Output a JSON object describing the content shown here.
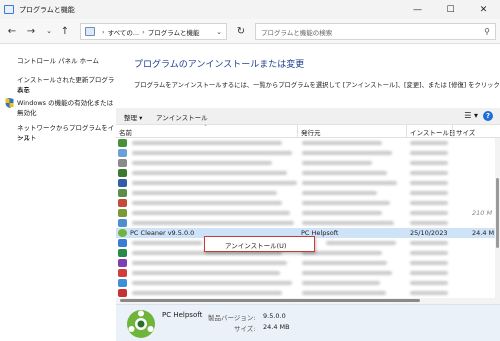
{
  "window": {
    "title": "プログラムと機能",
    "controls": [
      "minimize",
      "maximize",
      "close"
    ]
  },
  "nav": {
    "back_icon": "arrow-left-icon",
    "forward_icon": "arrow-right-icon",
    "recent_icon": "chevron-down-icon",
    "up_icon": "arrow-up-icon",
    "breadcrumb": [
      "すべての...",
      "プログラムと機能"
    ],
    "search_placeholder": "プログラムと機能の検索"
  },
  "sidebar": {
    "home": "コントロール パネル ホーム",
    "updates_line1": "インストールされた更新プログラムを",
    "updates_line2": "表示",
    "features_line1": "Windows の機能の有効化または",
    "features_line2": "無効化",
    "network_line1": "ネットワークからプログラムをインスト",
    "network_line2": "ール"
  },
  "main": {
    "heading": "プログラムのアンインストールまたは変更",
    "description": "プログラムをアンインストールするには、一覧からプログラムを選択して [アンインストール]、[変更]、または [修復] をクリックします。"
  },
  "toolbar": {
    "organize": "整理",
    "uninstall": "アンインストール"
  },
  "columns": {
    "name": "名前",
    "publisher": "発行元",
    "installed": "インストール日",
    "size": "サイズ"
  },
  "selected_program": {
    "name": "PC Cleaner v9.5.0.0",
    "publisher": "PC Helpsoft",
    "installed_on": "25/10/2023",
    "size": "24.4 M"
  },
  "partial_size_above": "210 M",
  "context_menu": {
    "item": "アンインストール(U)"
  },
  "details": {
    "publisher": "PC Helpsoft",
    "version_label": "製品バージョン:",
    "version": "9.5.0.0",
    "size_label": "サイズ:",
    "size": "24.4 MB"
  },
  "colors": {
    "heading": "#1e3f8f",
    "selection": "#cfe3f8",
    "menu_border": "#c93b3b",
    "details_bg": "#eaf1f9"
  }
}
